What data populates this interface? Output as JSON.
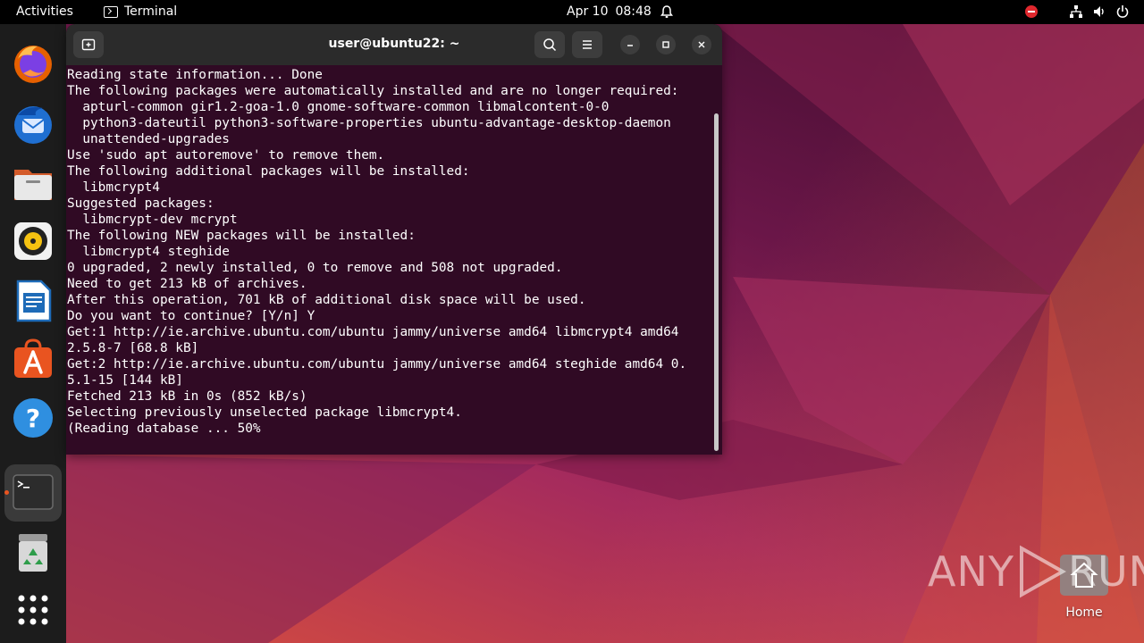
{
  "topbar": {
    "activities": "Activities",
    "app_name": "Terminal",
    "date": "Apr 10",
    "time": "08:48"
  },
  "dock": {
    "items": [
      {
        "name": "Firefox",
        "icon": "firefox-icon"
      },
      {
        "name": "Thunderbird",
        "icon": "thunderbird-icon"
      },
      {
        "name": "Files",
        "icon": "files-icon"
      },
      {
        "name": "Rhythmbox",
        "icon": "rhythmbox-icon"
      },
      {
        "name": "LibreOffice Writer",
        "icon": "writer-icon"
      },
      {
        "name": "Ubuntu Software",
        "icon": "software-icon"
      },
      {
        "name": "Help",
        "icon": "help-icon"
      },
      {
        "name": "Terminal",
        "icon": "terminal-icon"
      },
      {
        "name": "Trash",
        "icon": "trash-icon"
      },
      {
        "name": "Show Applications",
        "icon": "grid-icon"
      }
    ]
  },
  "terminal": {
    "title": "user@ubuntu22: ~",
    "lines": [
      "Reading state information... Done",
      "The following packages were automatically installed and are no longer required:",
      "  apturl-common gir1.2-goa-1.0 gnome-software-common libmalcontent-0-0",
      "  python3-dateutil python3-software-properties ubuntu-advantage-desktop-daemon",
      "  unattended-upgrades",
      "Use 'sudo apt autoremove' to remove them.",
      "The following additional packages will be installed:",
      "  libmcrypt4",
      "Suggested packages:",
      "  libmcrypt-dev mcrypt",
      "The following NEW packages will be installed:",
      "  libmcrypt4 steghide",
      "0 upgraded, 2 newly installed, 0 to remove and 508 not upgraded.",
      "Need to get 213 kB of archives.",
      "After this operation, 701 kB of additional disk space will be used.",
      "Do you want to continue? [Y/n] Y",
      "Get:1 http://ie.archive.ubuntu.com/ubuntu jammy/universe amd64 libmcrypt4 amd64",
      "2.5.8-7 [68.8 kB]",
      "Get:2 http://ie.archive.ubuntu.com/ubuntu jammy/universe amd64 steghide amd64 0.",
      "5.1-15 [144 kB]",
      "Fetched 213 kB in 0s (852 kB/s)",
      "Selecting previously unselected package libmcrypt4.",
      "(Reading database ... 50%"
    ]
  },
  "desktop": {
    "home_label": "Home"
  },
  "watermark": {
    "left": "ANY",
    "right": "RUN"
  },
  "colors": {
    "terminal_bg": "#300a24",
    "accent": "#e95420",
    "titlebar": "#2b2b2b"
  }
}
